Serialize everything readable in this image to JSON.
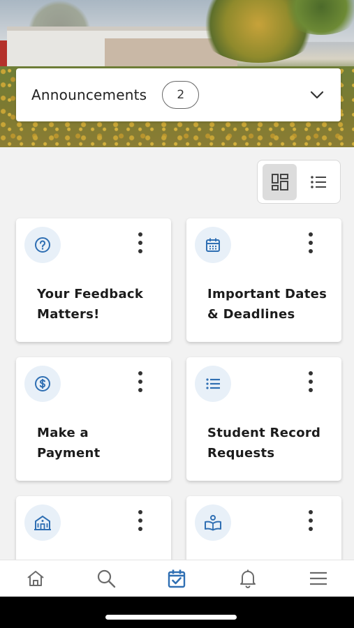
{
  "announcements": {
    "title": "Announcements",
    "count": "2"
  },
  "view_toggle": {
    "options": [
      "grid-view",
      "list-view"
    ],
    "selected": "grid-view"
  },
  "cards": [
    {
      "label": "Your Feedback\nMatters!",
      "icon": "question-circle-icon"
    },
    {
      "label": "Important Dates\n& Deadlines",
      "icon": "calendar-icon"
    },
    {
      "label": "Make a\nPayment",
      "icon": "dollar-circle-icon"
    },
    {
      "label": "Student Record\nRequests",
      "icon": "list-icon"
    },
    {
      "label": "",
      "icon": "building-icon"
    },
    {
      "label": "",
      "icon": "book-reader-icon"
    }
  ],
  "bottom_nav": {
    "items": [
      "home",
      "search",
      "calendar",
      "notifications",
      "menu"
    ],
    "active": "calendar"
  },
  "colors": {
    "accent": "#2f6fb3",
    "icon_bg": "#e8f0f8",
    "nav_icon": "#6b6b6b"
  }
}
